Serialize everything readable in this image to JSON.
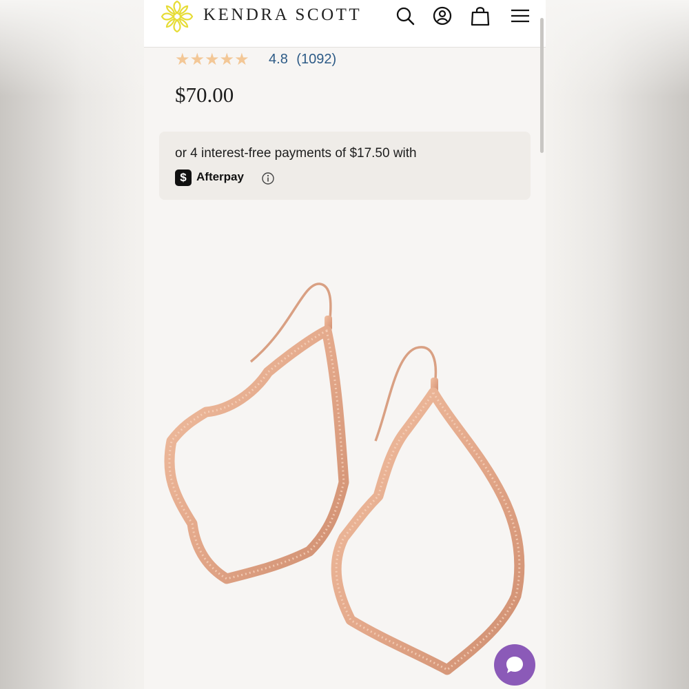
{
  "header": {
    "brand": "KENDRA SCOTT",
    "icons": [
      "kendra-scott-logo-icon",
      "search-icon",
      "account-icon",
      "shopping-bag-icon",
      "menu-icon"
    ]
  },
  "product": {
    "stars": "★★★★★",
    "rating_value": "4.8",
    "review_count": "(1092)",
    "price": "$70.00"
  },
  "afterpay": {
    "text": "or 4 interest-free payments of $17.50 with",
    "brand_name": "Afterpay",
    "logo_glyph": "$"
  },
  "colors": {
    "brand_gold": "#e6dc35",
    "star": "#f3c796",
    "rating_link": "#2c5a86",
    "chat_button": "#8b5ab8",
    "earring": "#e3a88a"
  }
}
